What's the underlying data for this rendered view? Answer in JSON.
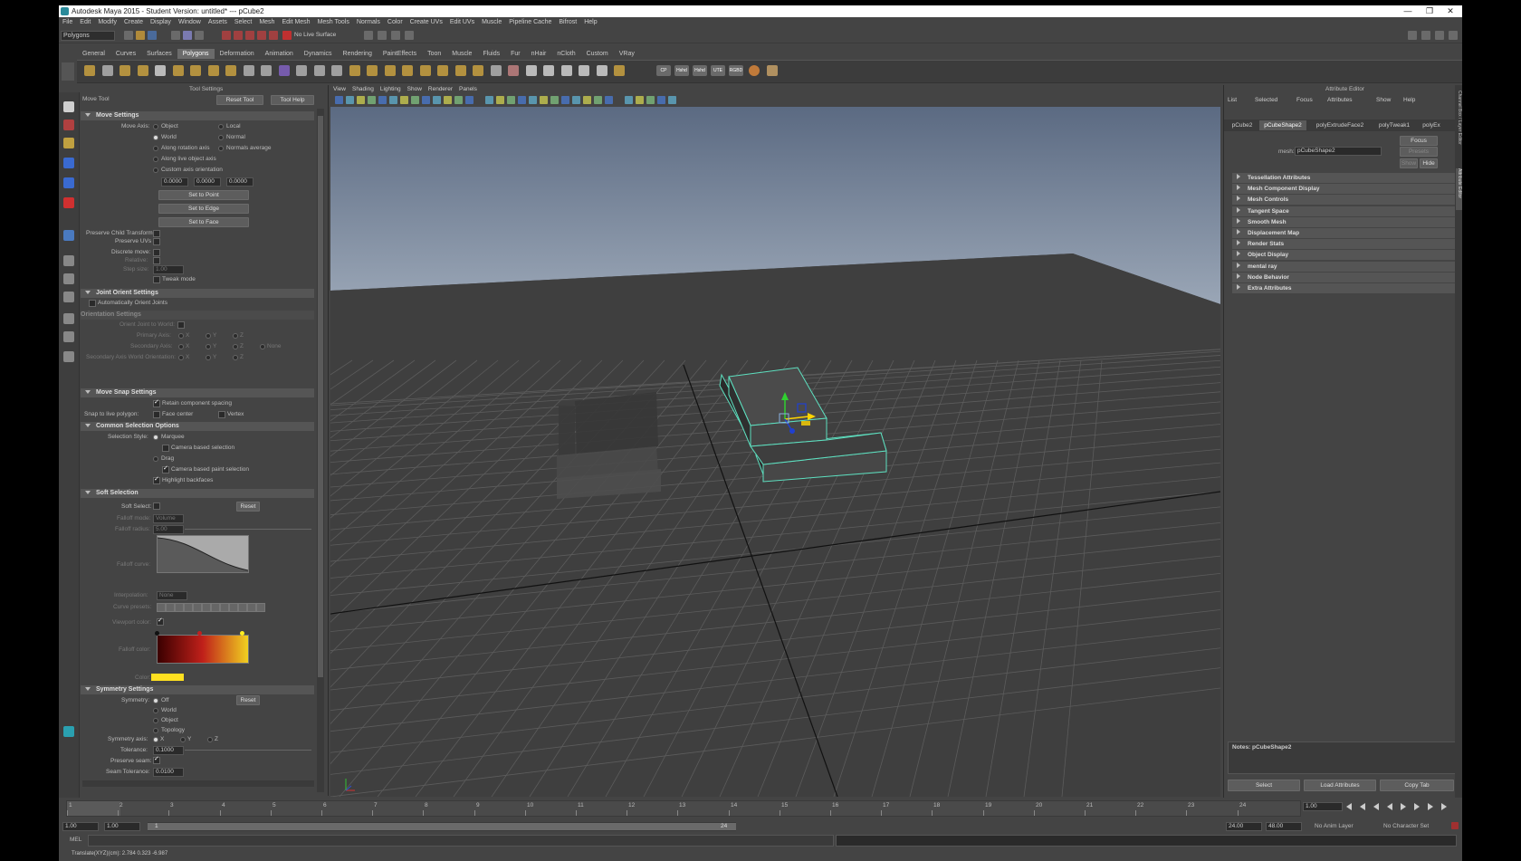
{
  "window": {
    "title": "Autodesk Maya 2015 - Student Version: untitled*   ---   pCube2",
    "controls": [
      "—",
      "❐",
      "✕"
    ]
  },
  "menubar": [
    "File",
    "Edit",
    "Modify",
    "Create",
    "Display",
    "Window",
    "Assets",
    "Select",
    "Mesh",
    "Edit Mesh",
    "Mesh Tools",
    "Normals",
    "Color",
    "Create UVs",
    "Edit UVs",
    "Muscle",
    "Pipeline Cache",
    "Bifrost",
    "Help"
  ],
  "statusline": {
    "mode": "Polygons",
    "live_surface": "No Live Surface"
  },
  "shelf": {
    "tabs": [
      "General",
      "Curves",
      "Surfaces",
      "Polygons",
      "Deformation",
      "Animation",
      "Dynamics",
      "Rendering",
      "PaintEffects",
      "Toon",
      "Muscle",
      "Fluids",
      "Fur",
      "nHair",
      "nCloth",
      "Custom",
      "VRay"
    ],
    "active_tab": "Polygons",
    "text_icons": [
      "CP",
      "Hshd",
      "Hshd",
      "UTE",
      "RGBD"
    ]
  },
  "tool_settings": {
    "title": "Tool Settings",
    "tool_name": "Move Tool",
    "reset_tool": "Reset Tool",
    "tool_help": "Tool Help",
    "move_settings": {
      "header": "Move Settings",
      "move_axis_label": "Move Axis:",
      "axis_options": [
        "Object",
        "Local",
        "World",
        "Normal",
        "Along rotation axis",
        "Normals average",
        "Along live object axis",
        "Custom axis orientation"
      ],
      "selected_axis": "World",
      "xyz": [
        "0.0000",
        "0.0000",
        "0.0000"
      ],
      "set_to_point": "Set to Point",
      "set_to_edge": "Set to Edge",
      "set_to_face": "Set to Face",
      "preserve_child": "Preserve Child Transform",
      "preserve_uvs": "Preserve UVs",
      "discrete_move": "Discrete move:",
      "relative": "Relative:",
      "step_size_label": "Step size:",
      "step_size": "1.00",
      "tweak_mode": "Tweak mode"
    },
    "joint_orient": {
      "header": "Joint Orient Settings",
      "auto_orient": "Automatically Orient Joints",
      "orientation_settings": "Orientation Settings",
      "orient_to_world": "Orient Joint to World:",
      "primary_axis": "Primary Axis:",
      "secondary_axis": "Secondary Axis:",
      "secondary_world": "Secondary Axis World Orientation:",
      "x": "X",
      "y": "Y",
      "z": "Z",
      "none": "None"
    },
    "move_snap": {
      "header": "Move Snap Settings",
      "retain_spacing": "Retain component spacing",
      "snap_live_label": "Snap to live polygon:",
      "face_center": "Face center",
      "vertex": "Vertex"
    },
    "common_selection": {
      "header": "Common Selection Options",
      "style_label": "Selection Style:",
      "marquee": "Marquee",
      "camera_based": "Camera based selection",
      "drag": "Drag",
      "camera_paint": "Camera based paint selection",
      "highlight_backfaces": "Highlight backfaces"
    },
    "soft_selection": {
      "header": "Soft Selection",
      "soft_select_label": "Soft Select:",
      "reset": "Reset",
      "falloff_mode_label": "Falloff mode:",
      "falloff_mode": "Volume",
      "falloff_radius_label": "Falloff radius:",
      "falloff_radius": "5.00",
      "falloff_curve_label": "Falloff curve:",
      "interpolation_label": "Interpolation:",
      "interpolation": "None",
      "curve_presets_label": "Curve presets:",
      "viewport_color_label": "Viewport color:",
      "falloff_color_label": "Falloff color:",
      "color_label": "Color:",
      "gradient_start": "#3a0000",
      "gradient_mid": "#c0201a",
      "gradient_end": "#f0d020",
      "swatch": "#ffe020"
    },
    "symmetry": {
      "header": "Symmetry Settings",
      "symmetry_label": "Symmetry:",
      "reset": "Reset",
      "options": [
        "Off",
        "World",
        "Object",
        "Topology"
      ],
      "axis_label": "Symmetry axis:",
      "tolerance_label": "Tolerance:",
      "tolerance": "0.1000",
      "preserve_seam_label": "Preserve seam:",
      "seam_tolerance_label": "Seam Tolerance:",
      "seam_tolerance": "0.0100"
    }
  },
  "viewport": {
    "menus": [
      "View",
      "Shading",
      "Lighting",
      "Show",
      "Renderer",
      "Panels"
    ],
    "selected_color": "#60e0c0"
  },
  "attribute_editor": {
    "title": "Attribute Editor",
    "menus": [
      "List",
      "Selected",
      "Focus",
      "Attributes",
      "Show",
      "Help"
    ],
    "tabs": [
      "pCube2",
      "pCubeShape2",
      "polyExtrudeFace2",
      "polyTweak1",
      "polyEx"
    ],
    "active_tab": "pCubeShape2",
    "mesh_label": "mesh:",
    "mesh_value": "pCubeShape2",
    "focus": "Focus",
    "presets": "Presets",
    "show": "Show",
    "hide": "Hide",
    "sections": [
      "Tessellation Attributes",
      "Mesh Component Display",
      "Mesh Controls",
      "Tangent Space",
      "Smooth Mesh",
      "Displacement Map",
      "Render Stats",
      "Object Display",
      "mental ray",
      "Node Behavior",
      "Extra Attributes"
    ],
    "notes": "Notes: pCubeShape2",
    "buttons": [
      "Select",
      "Load Attributes",
      "Copy Tab"
    ],
    "side_tabs": [
      "Channel Box / Layer Editor",
      "Attribute Editor"
    ]
  },
  "timeline": {
    "ticks": [
      "1",
      "2",
      "3",
      "4",
      "5",
      "6",
      "7",
      "8",
      "9",
      "10",
      "11",
      "12",
      "13",
      "14",
      "15",
      "16",
      "17",
      "18",
      "19",
      "20",
      "21",
      "22",
      "23",
      "24"
    ],
    "current_frame": "1.00",
    "range_start": "1.00",
    "range_inner_start": "1.00",
    "slider_start": "1",
    "slider_end": "24",
    "range_end": "24.00",
    "range_outer_end": "48.00",
    "anim_layer": "No Anim Layer",
    "char_set": "No Character Set"
  },
  "cmdline": {
    "label": "MEL"
  },
  "helpline": {
    "text": "Translate(XYZ)(cm):   2.784   0.323   -6.987"
  }
}
